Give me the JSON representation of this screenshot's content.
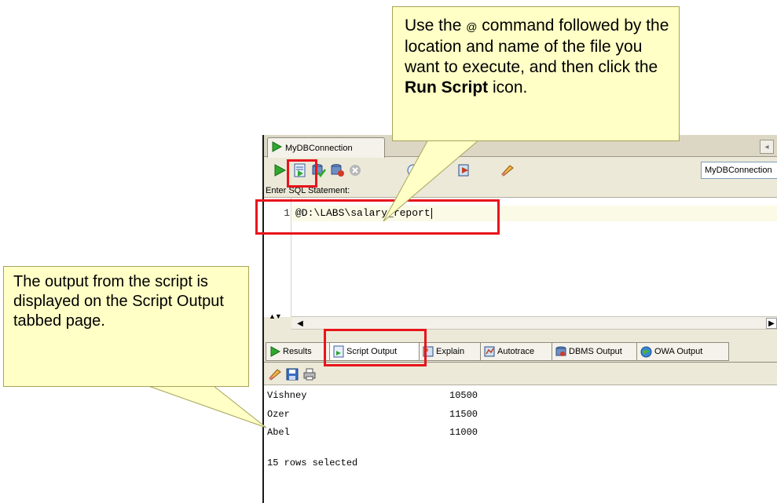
{
  "window": {
    "tab_title": "MyDBConnection",
    "connection_select_value": "MyDBConnection"
  },
  "editor": {
    "label": "Enter SQL Statement:",
    "line_number": "1",
    "line_text": "@D:\\LABS\\salary_report"
  },
  "result_tabs": [
    {
      "label": "Results",
      "icon": "run-icon"
    },
    {
      "label": "Script Output",
      "icon": "script-output-icon",
      "active": true
    },
    {
      "label": "Explain",
      "icon": "explain-icon"
    },
    {
      "label": "Autotrace",
      "icon": "autotrace-icon"
    },
    {
      "label": "DBMS Output",
      "icon": "dbms-output-icon"
    },
    {
      "label": "OWA Output",
      "icon": "owa-output-icon"
    }
  ],
  "output_rows": [
    {
      "name": "Vishney",
      "salary": "10500"
    },
    {
      "name": "Ozer",
      "salary": "11500"
    },
    {
      "name": "Abel",
      "salary": "11000"
    }
  ],
  "output_footer": "15 rows selected",
  "callouts": {
    "top_part1": "Use the ",
    "top_at": "@",
    "top_part2": " command followed by the location and name of the file you want to execute, and then click the ",
    "top_bold": "Run Script",
    "top_part3": " icon.",
    "left": "The output from the script is displayed on the Script Output tabbed page."
  },
  "colors": {
    "highlight": "#e8141c",
    "callout_bg": "#ffffc6",
    "window_bg": "#ece9d8"
  }
}
